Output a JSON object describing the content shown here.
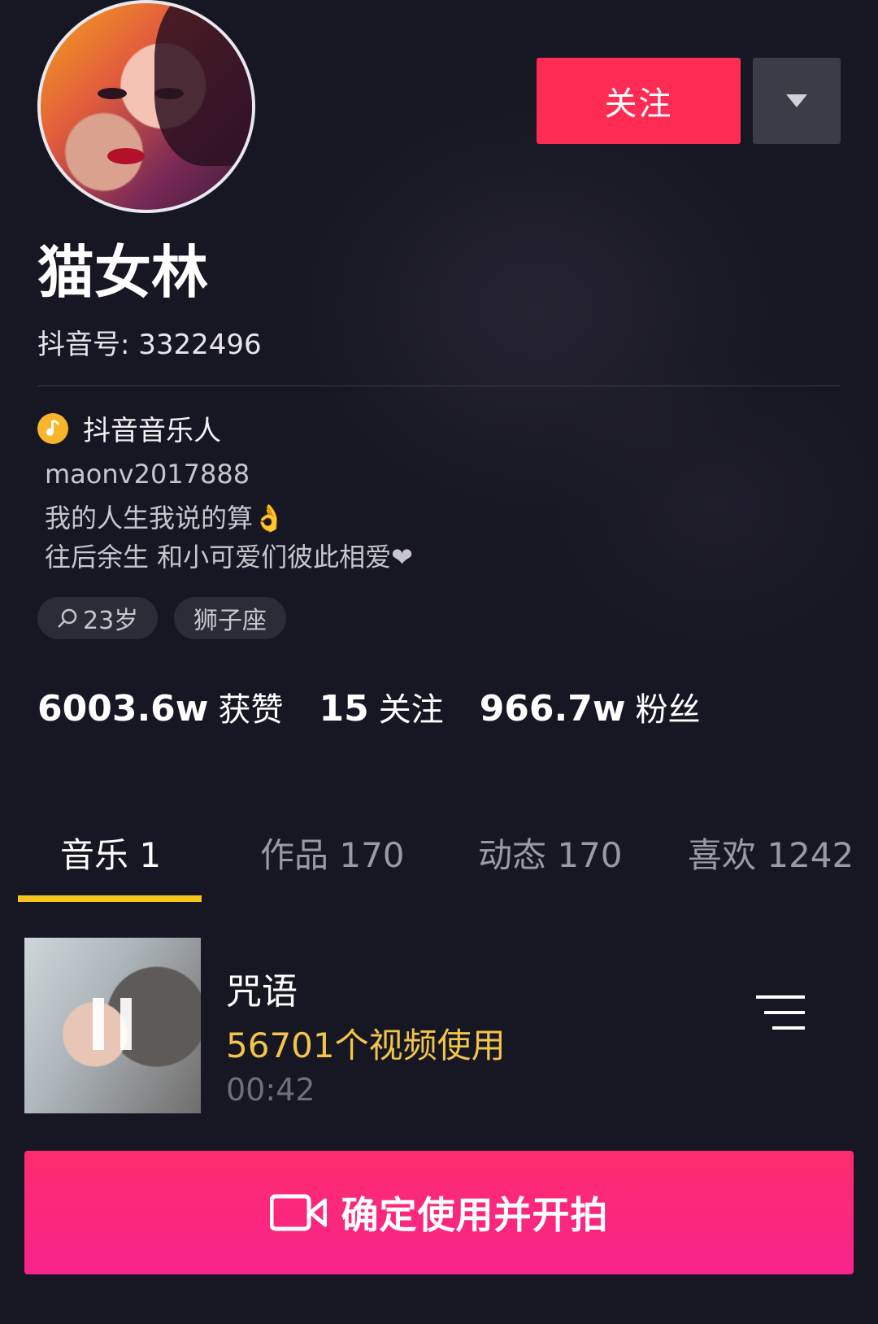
{
  "profile": {
    "name": "猫女林",
    "douyin_id": "抖音号: 3322496",
    "follow_label": "关注",
    "badge": "抖音音乐人",
    "bio_lines": [
      "maonv2017888",
      "我的人生我说的算👌",
      "往后余生 和小可爱们彼此相爱❤"
    ],
    "tags": [
      "23岁",
      "狮子座"
    ]
  },
  "stats": [
    {
      "num": "6003.6w",
      "label": "获赞"
    },
    {
      "num": "15",
      "label": "关注"
    },
    {
      "num": "966.7w",
      "label": "粉丝"
    }
  ],
  "tabs": [
    {
      "label": "音乐 1",
      "active": true
    },
    {
      "label": "作品 170",
      "active": false
    },
    {
      "label": "动态 170",
      "active": false
    },
    {
      "label": "喜欢 1242",
      "active": false
    }
  ],
  "track": {
    "title": "咒语",
    "uses": "56701个视频使用",
    "duration": "00:42"
  },
  "cta_label": "确定使用并开拍",
  "colors": {
    "background": "#161722",
    "accent": "#fe2c55",
    "tab_indicator": "#f8c51c",
    "uses_text": "#f2c44a"
  }
}
